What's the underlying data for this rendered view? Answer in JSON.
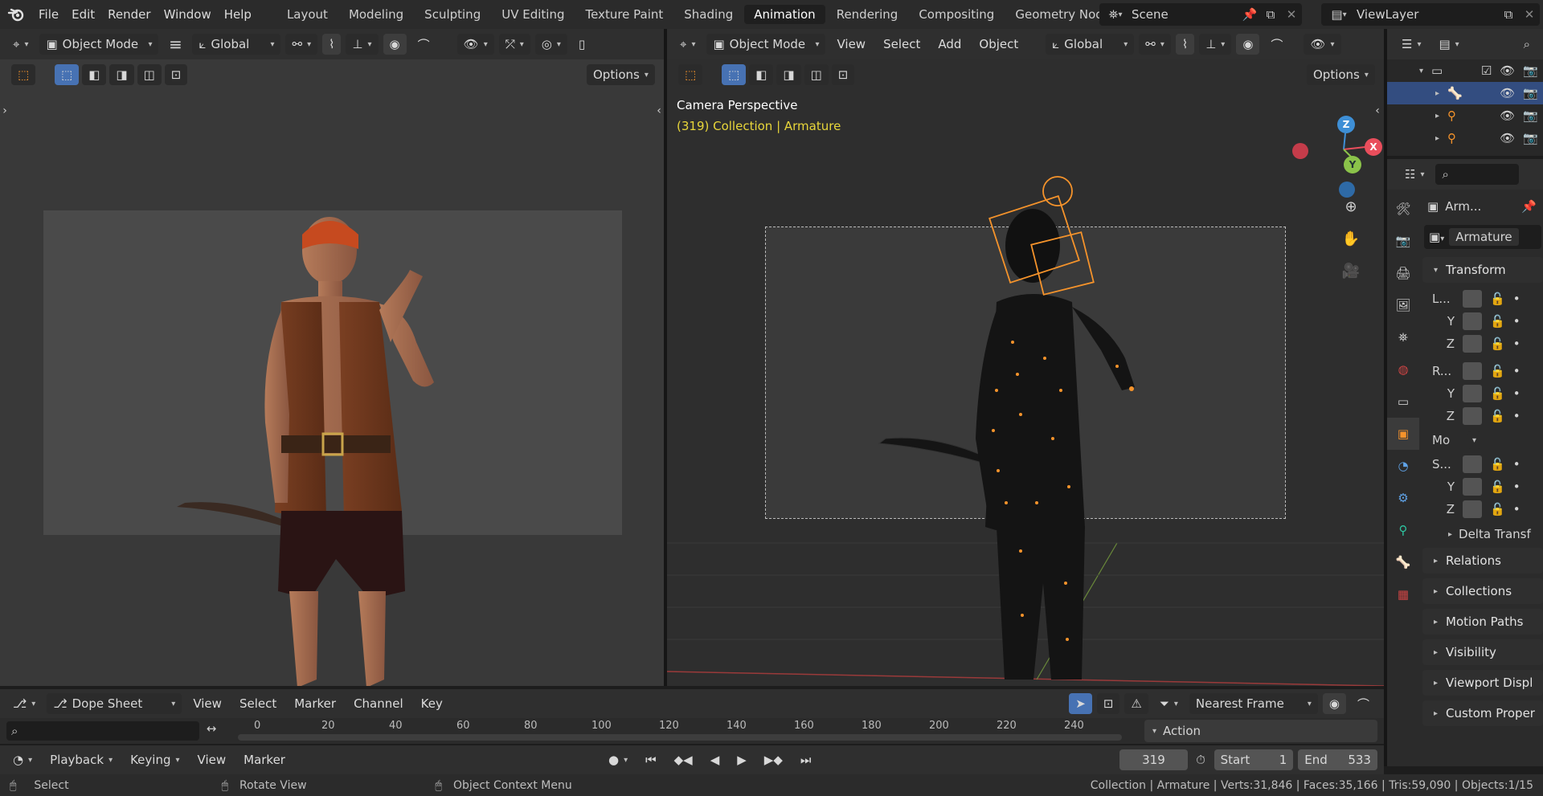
{
  "topbar": {
    "menus": [
      "File",
      "Edit",
      "Render",
      "Window",
      "Help"
    ],
    "tabs": [
      {
        "label": "Layout"
      },
      {
        "label": "Modeling"
      },
      {
        "label": "Sculpting"
      },
      {
        "label": "UV Editing"
      },
      {
        "label": "Texture Paint"
      },
      {
        "label": "Shading"
      },
      {
        "label": "Animation",
        "active": true
      },
      {
        "label": "Rendering"
      },
      {
        "label": "Compositing"
      },
      {
        "label": "Geometry Node"
      }
    ],
    "scene": "Scene",
    "view_layer": "ViewLayer"
  },
  "left_view": {
    "mode": "Object Mode",
    "orientation": "Global",
    "options": "Options"
  },
  "right_view": {
    "mode": "Object Mode",
    "menus": [
      "View",
      "Select",
      "Add",
      "Object"
    ],
    "orientation": "Global",
    "options": "Options",
    "title": "Camera Perspective",
    "subtitle": "(319) Collection | Armature",
    "gizmo": {
      "z": "Z",
      "y": "Y",
      "x": "X"
    }
  },
  "properties": {
    "object_name": "Arm...",
    "data_name": "Armature",
    "transform": "Transform",
    "loc": "L...",
    "rot": "R...",
    "mode": "Mo",
    "scale": "S...",
    "axis_y": "Y",
    "axis_z": "Z",
    "delta": "Delta Transf",
    "sections": [
      "Relations",
      "Collections",
      "Motion Paths",
      "Visibility",
      "Viewport Displ",
      "Custom Proper"
    ]
  },
  "dopesheet": {
    "editor": "Dope Sheet",
    "menus": [
      "View",
      "Select",
      "Marker",
      "Channel",
      "Key"
    ],
    "snap": "Nearest Frame",
    "ticks": [
      "0",
      "20",
      "40",
      "60",
      "80",
      "100",
      "120",
      "140",
      "160",
      "180",
      "200",
      "220",
      "240"
    ],
    "action": "Action"
  },
  "timeline": {
    "playback": "Playback",
    "keying": "Keying",
    "view": "View",
    "marker": "Marker",
    "current_frame": "319",
    "start_label": "Start",
    "start": "1",
    "end_label": "End",
    "end": "533"
  },
  "statusbar": {
    "select": "Select",
    "rotate": "Rotate View",
    "context": "Object Context Menu",
    "stats": "Collection | Armature | Verts:31,846 | Faces:35,166 | Tris:59,090 | Objects:1/15"
  },
  "colors": {
    "accent": "#4772b3",
    "selection_orange": "#f5932b",
    "header_text_yellow": "#e8d63a",
    "axis_x": "#e94e5c",
    "axis_y": "#8bc34a",
    "axis_z": "#3e8fd6"
  }
}
